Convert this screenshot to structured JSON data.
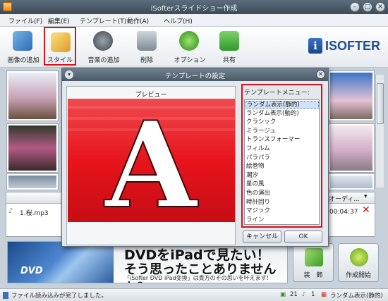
{
  "window": {
    "title": "iSofterスライドショー作成"
  },
  "menu": [
    "ファイル(F)",
    "編集(E)",
    "テンプレート(T)",
    "動作(A)",
    "ヘルプ(H)"
  ],
  "toolbar": {
    "add_image": "画像の追加",
    "style": "スタイル",
    "add_music": "音楽の追加",
    "delete": "削除",
    "options": "オプション",
    "share": "共有"
  },
  "logo": {
    "mark": "i",
    "text": "ISOFTER"
  },
  "dialog": {
    "title": "テンプレートの設定",
    "preview_label": "プレビュー",
    "preview_letter": "A",
    "menu_label": "テンプレートメニュー:",
    "templates": [
      "ランダム表示(静的)",
      "ランダム表示(動的)",
      "クラシック",
      "ミラージュ",
      "トランスフォーマー",
      "フィルム",
      "パラパラ",
      "絵巻物",
      "潮汐",
      "星の風",
      "色の演出",
      "時計回り",
      "マジック",
      "ライン"
    ],
    "selected_index": 0,
    "cancel": "キャンセル",
    "ok": "OK"
  },
  "music": {
    "col_audio": "オーディ...",
    "file": "1.桜.mp3",
    "duration": "00:04:37"
  },
  "banner": {
    "line1": "DVDをiPadで見たい！",
    "line2": "そう思ったことありませんか？",
    "line3": "「iSofter DVD iPad変換」は貴方のその思いを叶えます！",
    "dvd_text": "DVD"
  },
  "buttons": {
    "decorate": "装　飾",
    "start": "作成開始"
  },
  "status": {
    "message": "ファイル読み込みが完了しました。",
    "image_count": "21",
    "music_count": "1",
    "template": "ランダム表示(静的)"
  },
  "colors": {
    "highlight": "#d9101a",
    "preview_red": "#e8141c"
  }
}
